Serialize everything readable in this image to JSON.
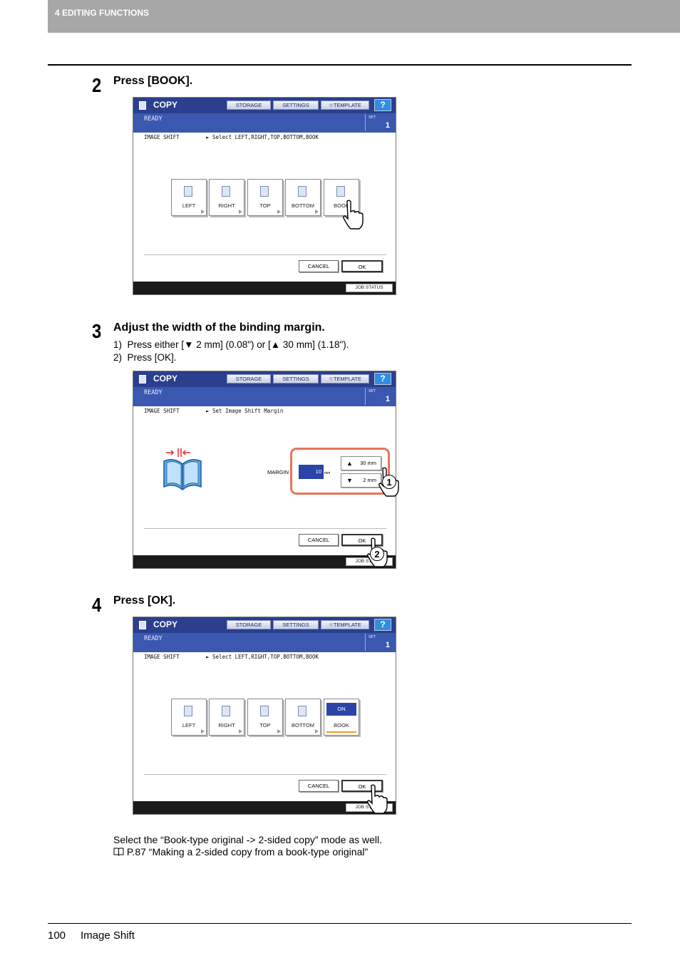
{
  "header": {
    "section": "4 EDITING FUNCTIONS"
  },
  "steps": [
    {
      "number": "2",
      "heading": "Press [BOOK]."
    },
    {
      "number": "3",
      "heading": "Adjust the width of the binding margin.",
      "substeps": [
        {
          "num": "1)",
          "pre": "Press either [",
          "down": "2 mm] (0.08\") or [",
          "up": "30 mm] (1.18\")."
        },
        {
          "num": "2)",
          "text": "Press [OK]."
        }
      ]
    },
    {
      "number": "4",
      "heading": "Press [OK]."
    }
  ],
  "screen": {
    "copy_label": "COPY",
    "storage": "STORAGE",
    "settings": "SETTINGS",
    "template": "TEMPLATE",
    "help": "?",
    "ready": "READY",
    "set_label": "SET",
    "set_count": "1",
    "mode_label": "IMAGE SHIFT",
    "select_msg": "► Select LEFT,RIGHT,TOP,BOTTOM,BOOK",
    "margin_msg": "► Set Image Shift Margin",
    "buttons": {
      "left": "LEFT",
      "right": "RIGHT",
      "top": "TOP",
      "bottom": "BOTTOM",
      "book": "BOOK"
    },
    "on_label": "ON",
    "margin_label": "MARGIN",
    "margin_value": "10",
    "margin_unit": "mm",
    "up_btn": "30 mm",
    "down_btn": "2 mm",
    "cancel": "CANCEL",
    "ok": "OK",
    "job_status": "JOB STATUS"
  },
  "note": {
    "line1": "Select the “Book-type original -> 2-sided copy” mode as well.",
    "line2": "P.87 “Making a 2-sided copy from a book-type original”"
  },
  "footer": {
    "page_number": "100",
    "title": "Image Shift"
  },
  "callouts": [
    "1",
    "2"
  ]
}
